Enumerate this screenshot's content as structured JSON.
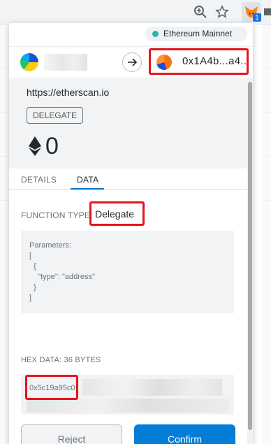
{
  "browser": {
    "extension_badge": "1"
  },
  "popup": {
    "network": "Ethereum Mainnet",
    "recipient_address": "0x1A4b...a4...",
    "origin": "https://etherscan.io",
    "action": "DELEGATE",
    "amount": "0",
    "tabs": {
      "details": "DETAILS",
      "data": "DATA"
    },
    "function_type_label": "FUNCTION TYPE:",
    "function_type_value": "Delegate",
    "parameters_text": "Parameters:\n[\n  {\n    \"type\": \"address\"\n  }\n]",
    "hex_label": "HEX DATA: 36 BYTES",
    "hex_value": "0x5c19a95c0",
    "reject_label": "Reject",
    "confirm_label": "Confirm"
  },
  "colors": {
    "accent": "#037dd6",
    "highlight": "#e8131c",
    "network_dot": "#29b6af"
  }
}
